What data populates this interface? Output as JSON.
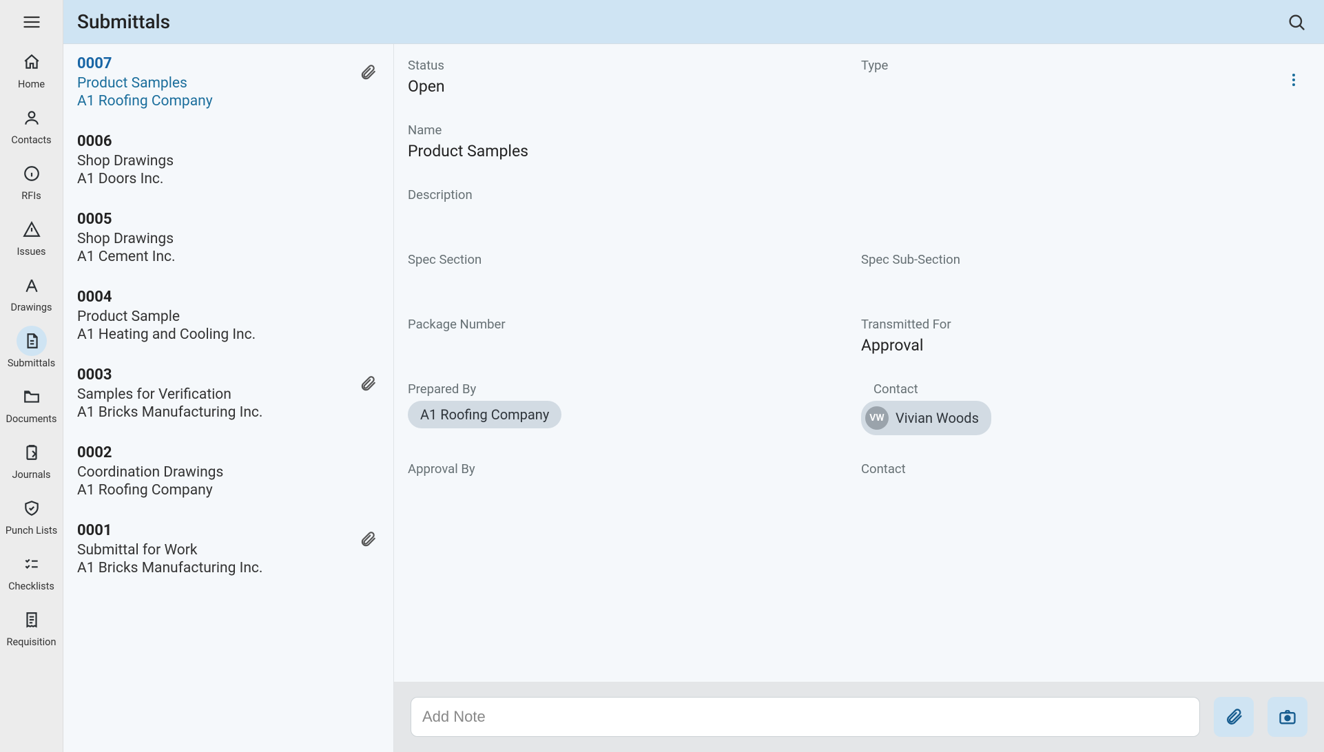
{
  "header": {
    "title": "Submittals"
  },
  "nav": [
    {
      "key": "home",
      "label": "Home",
      "icon": "home-icon"
    },
    {
      "key": "contacts",
      "label": "Contacts",
      "icon": "person-icon"
    },
    {
      "key": "rfis",
      "label": "RFIs",
      "icon": "info-icon"
    },
    {
      "key": "issues",
      "label": "Issues",
      "icon": "warning-icon"
    },
    {
      "key": "drawings",
      "label": "Drawings",
      "icon": "drafting-icon"
    },
    {
      "key": "submittals",
      "label": "Submittals",
      "icon": "file-icon",
      "active": true
    },
    {
      "key": "documents",
      "label": "Documents",
      "icon": "folder-icon"
    },
    {
      "key": "journals",
      "label": "Journals",
      "icon": "clipboard-icon"
    },
    {
      "key": "punchlists",
      "label": "Punch Lists",
      "icon": "shield-check-icon"
    },
    {
      "key": "checklists",
      "label": "Checklists",
      "icon": "checklist-icon"
    },
    {
      "key": "requisition",
      "label": "Requisition",
      "icon": "receipt-icon"
    }
  ],
  "submittals": [
    {
      "number": "0007",
      "title": "Product Samples",
      "company": "A1 Roofing Company",
      "attachment": true,
      "selected": true
    },
    {
      "number": "0006",
      "title": "Shop Drawings",
      "company": "A1 Doors Inc.",
      "attachment": false,
      "selected": false
    },
    {
      "number": "0005",
      "title": "Shop Drawings",
      "company": "A1 Cement Inc.",
      "attachment": false,
      "selected": false
    },
    {
      "number": "0004",
      "title": "Product Sample",
      "company": "A1 Heating and Cooling Inc.",
      "attachment": false,
      "selected": false
    },
    {
      "number": "0003",
      "title": "Samples for Verification",
      "company": "A1 Bricks Manufacturing Inc.",
      "attachment": true,
      "selected": false
    },
    {
      "number": "0002",
      "title": "Coordination Drawings",
      "company": "A1 Roofing Company",
      "attachment": false,
      "selected": false
    },
    {
      "number": "0001",
      "title": "Submittal for Work",
      "company": "A1 Bricks Manufacturing Inc.",
      "attachment": true,
      "selected": false
    }
  ],
  "detail": {
    "labels": {
      "status": "Status",
      "type": "Type",
      "name": "Name",
      "description": "Description",
      "spec_section": "Spec Section",
      "spec_sub_section": "Spec Sub-Section",
      "package_number": "Package Number",
      "transmitted_for": "Transmitted For",
      "prepared_by": "Prepared By",
      "prepared_contact": "Contact",
      "approval_by": "Approval By",
      "approval_contact": "Contact"
    },
    "values": {
      "status": "Open",
      "type": "",
      "name": "Product Samples",
      "description": "",
      "spec_section": "",
      "spec_sub_section": "",
      "package_number": "",
      "transmitted_for": "Approval",
      "prepared_by": "A1 Roofing Company",
      "prepared_contact_name": "Vivian Woods",
      "prepared_contact_initials": "VW",
      "approval_by": "",
      "approval_contact": ""
    }
  },
  "noteBar": {
    "placeholder": "Add Note"
  }
}
